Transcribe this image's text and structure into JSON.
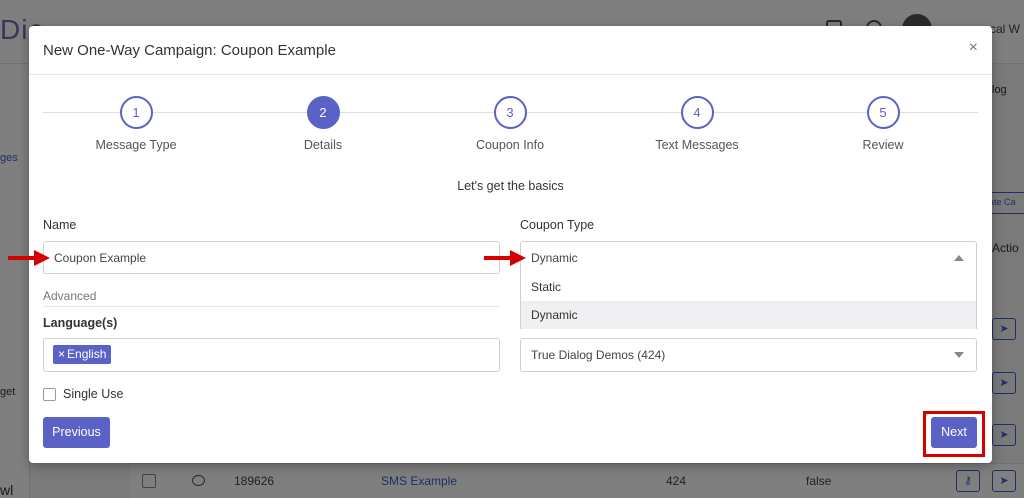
{
  "background": {
    "brand_partial": "Dia",
    "user_partial": "cal W",
    "sidebar_texts": [
      "ges",
      "get",
      "wl"
    ],
    "right_texts": [
      "log",
      "Actio"
    ],
    "right_button": "ate Ca",
    "row": {
      "id": "189626",
      "name": "SMS Example",
      "count": "424",
      "flag": "false"
    }
  },
  "modal": {
    "title": "New One-Way Campaign: Coupon Example",
    "close_glyph": "×",
    "steps": [
      {
        "number": "1",
        "label": "Message Type",
        "active": false
      },
      {
        "number": "2",
        "label": "Details",
        "active": true
      },
      {
        "number": "3",
        "label": "Coupon Info",
        "active": false
      },
      {
        "number": "4",
        "label": "Text Messages",
        "active": false
      },
      {
        "number": "5",
        "label": "Review",
        "active": false
      }
    ],
    "intro": "Let's get the basics",
    "name_field": {
      "label": "Name",
      "value": "Coupon Example"
    },
    "coupon_type": {
      "label": "Coupon Type",
      "selected": "Dynamic",
      "options": [
        "Static",
        "Dynamic"
      ]
    },
    "advanced_label": "Advanced",
    "language": {
      "label": "Language(s)",
      "tag_remove": "×",
      "tag": "English"
    },
    "account_select": {
      "value": "True Dialog Demos (424)"
    },
    "single_use": {
      "label": "Single Use",
      "checked": false
    },
    "previous_label": "Previous",
    "next_label": "Next"
  },
  "colors": {
    "accent": "#5a62c6",
    "annotation": "#d40000"
  }
}
